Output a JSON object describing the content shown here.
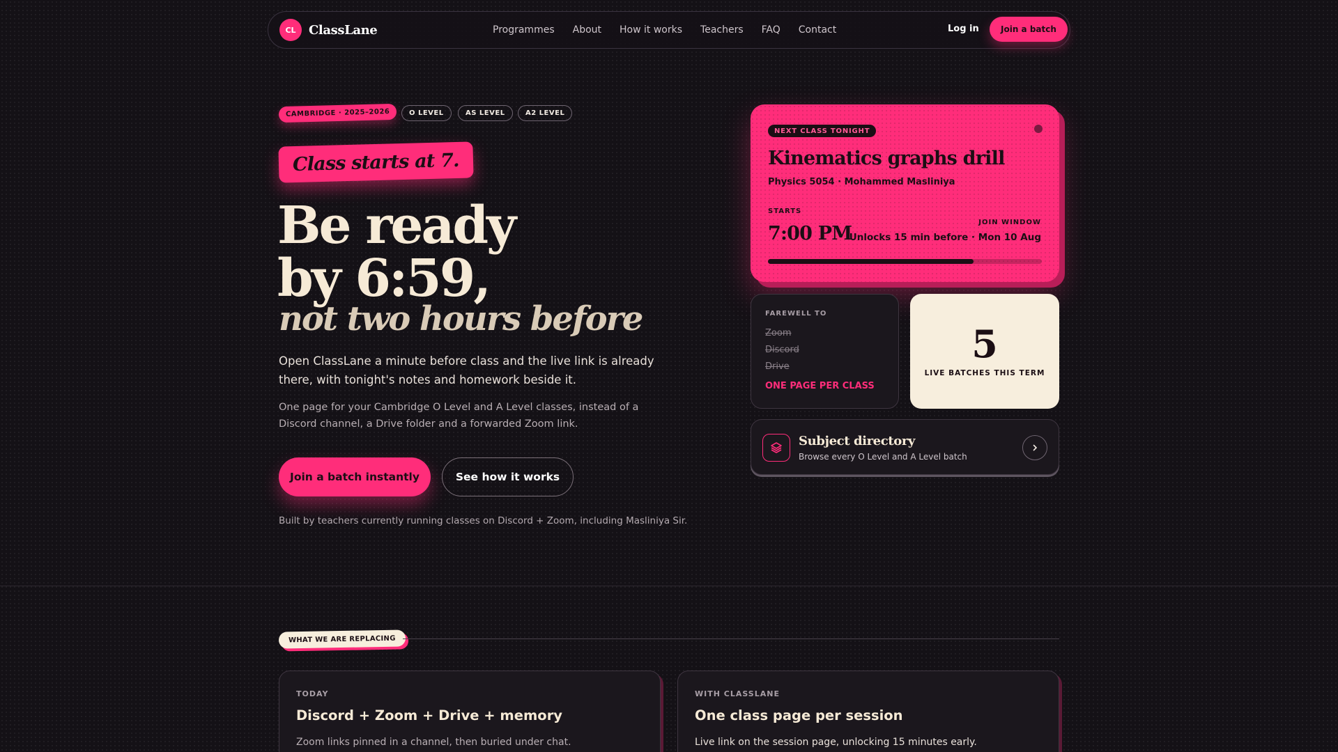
{
  "nav": {
    "logo_initials": "CL",
    "brand": "ClassLane",
    "links": [
      "Programmes",
      "About",
      "How it works",
      "Teachers",
      "FAQ",
      "Contact"
    ],
    "login": "Log in",
    "cta": "Join a batch"
  },
  "hero": {
    "tags": [
      "CAMBRIDGE · 2025–2026",
      "O LEVEL",
      "AS LEVEL",
      "A2 LEVEL"
    ],
    "stamp": "Class starts at 7.",
    "headline_line1": "Be ready",
    "headline_line2": "by 6:59,",
    "headline_italic": "not two hours before",
    "lead": "Open ClassLane a minute before class and the live link is already there, with tonight's notes and homework beside it.",
    "sublead": "One page for your Cambridge O Level and A Level classes, instead of a Discord channel, a Drive folder and a forwarded Zoom link.",
    "primary_cta": "Join a batch instantly",
    "secondary_cta": "See how it works",
    "credit": "Built by teachers currently running classes on Discord + Zoom, including Masliniya Sir."
  },
  "next_class": {
    "badge": "NEXT CLASS TONIGHT",
    "title": "Kinematics graphs drill",
    "subtitle": "Physics 5054 · Mohammed Masliniya",
    "starts_label": "STARTS",
    "time": "7:00 PM",
    "window_label": "JOIN WINDOW",
    "window_text": "Unlocks 15 min before · Mon 10 Aug",
    "progress": 0.75
  },
  "farewell": {
    "label": "FAREWELL TO",
    "items": [
      "Zoom",
      "Discord",
      "Drive"
    ],
    "cta": "ONE PAGE PER CLASS"
  },
  "batches": {
    "count": "5",
    "label": "LIVE BATCHES THIS TERM"
  },
  "directory": {
    "title": "Subject directory",
    "subtitle": "Browse every O Level and A Level batch",
    "icon": "layers-icon",
    "arrow_icon": "chevron-right-icon"
  },
  "replacing": {
    "pill": "WHAT WE ARE REPLACING",
    "today": {
      "label": "TODAY",
      "title": "Discord + Zoom + Drive + memory",
      "desc": "Zoom links pinned in a channel, then buried under chat."
    },
    "classlane": {
      "label": "WITH CLASSLANE",
      "title": "One class page per session",
      "desc": "Live link on the session page, unlocking 15 minutes early."
    }
  },
  "colors": {
    "accent": "#ff2d7a",
    "background": "#141116",
    "cream": "#f7eedd"
  }
}
